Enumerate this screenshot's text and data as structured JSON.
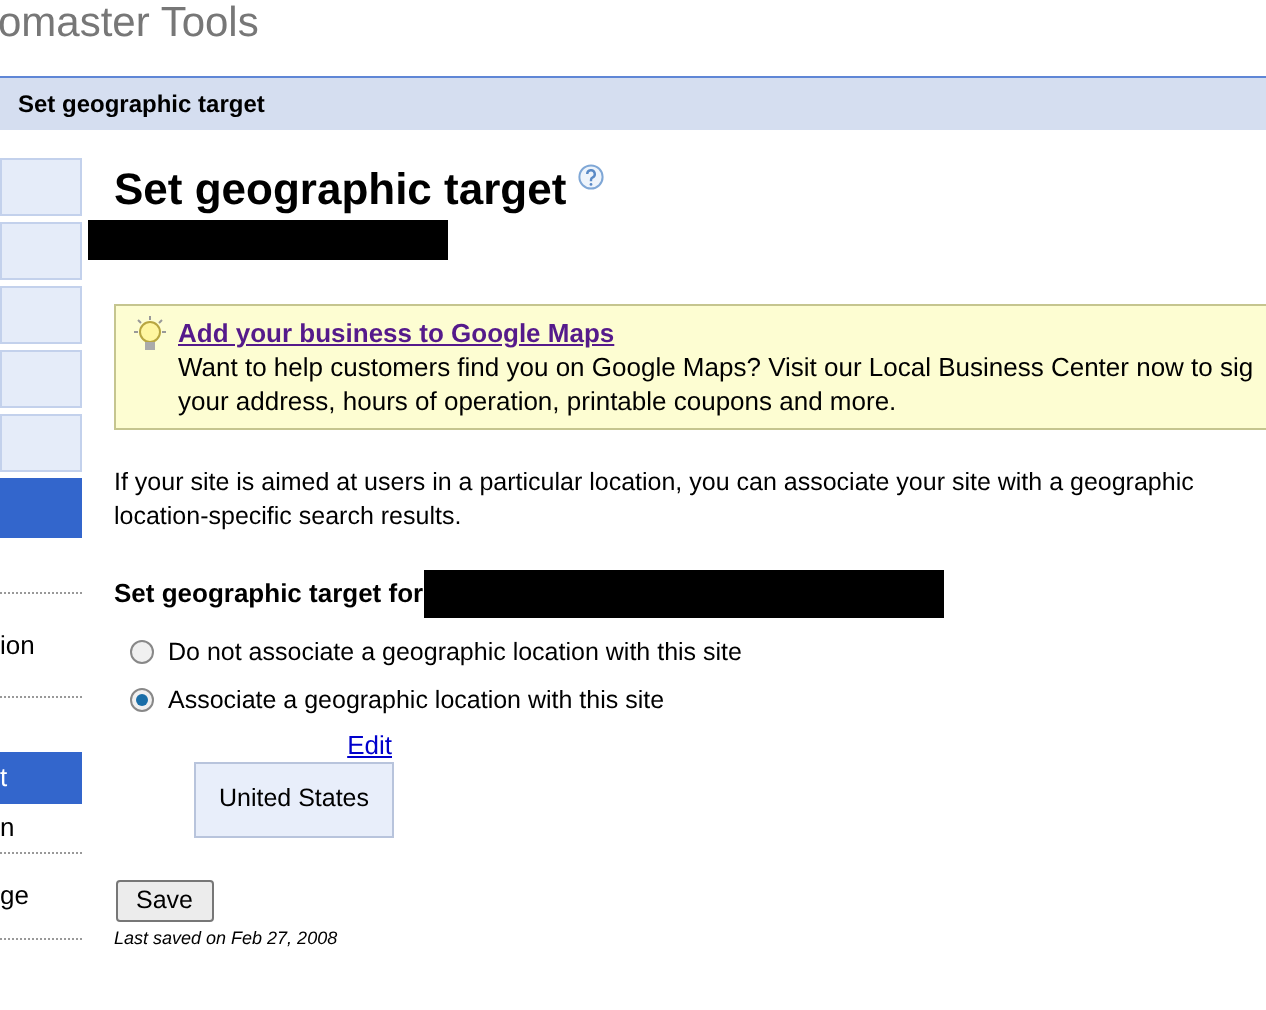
{
  "header": {
    "title": "omaster Tools"
  },
  "breadcrumb": "Set geographic target",
  "sidebar": {
    "blocks": [
      {
        "selected": false
      },
      {
        "selected": false
      },
      {
        "selected": false
      },
      {
        "selected": false
      },
      {
        "selected": false
      },
      {
        "selected": true
      }
    ],
    "items": [
      {
        "label": "ion",
        "selected": false
      },
      {
        "label": "t",
        "selected": true
      },
      {
        "label": "n",
        "selected": false
      },
      {
        "label": "ge",
        "selected": false
      }
    ]
  },
  "page": {
    "title": "Set geographic target",
    "notice": {
      "link": "Add your business to Google Maps",
      "text": "Want to help customers find you on Google Maps? Visit our Local Business Center now to sig your address, hours of operation, printable coupons and more."
    },
    "intro": "If your site is aimed at users in a particular location, you can associate your site with a geographic location-specific search results.",
    "target_label": "Set geographic target for",
    "options": [
      {
        "label": "Do not associate a geographic location with this site",
        "selected": false
      },
      {
        "label": "Associate a geographic location with this site",
        "selected": true
      }
    ],
    "edit_link": "Edit",
    "location": "United States",
    "save_button": "Save",
    "last_saved": "Last saved on Feb 27, 2008"
  }
}
